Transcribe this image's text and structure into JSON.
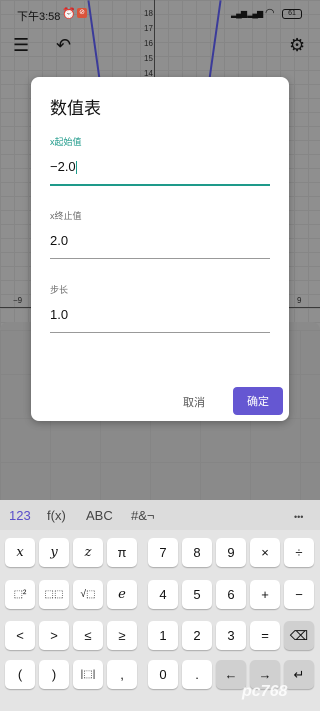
{
  "status": {
    "time": "下午3:58",
    "alarm_icon": "alarm-icon",
    "notif": "⊘",
    "battery": "61"
  },
  "toolbar": {
    "menu_icon": "menu-icon",
    "undo_icon": "undo-icon",
    "settings_icon": "gear-icon"
  },
  "graph": {
    "y_ticks": [
      "18",
      "17",
      "16",
      "15",
      "14"
    ],
    "x_ticks": [
      "−9",
      "9"
    ]
  },
  "dialog": {
    "title": "数值表",
    "fields": [
      {
        "label": "x起始值",
        "value": "−2.0"
      },
      {
        "label": "x终止值",
        "value": "2.0"
      },
      {
        "label": "步长",
        "value": "1.0"
      }
    ],
    "cancel": "取消",
    "ok": "确定"
  },
  "keyboard": {
    "tabs": [
      "123",
      "f(x)",
      "ABC",
      "#&¬"
    ],
    "more": "•••",
    "keys": {
      "x": "x",
      "y": "y",
      "z": "z",
      "pi": "π",
      "sq": "⬚²",
      "pow": "⬚⬚",
      "sqrt": "√⬚",
      "e": "e",
      "lt": "<",
      "gt": ">",
      "le": "≤",
      "ge": "≥",
      "lparen": "(",
      "rparen": ")",
      "abs": "|⬚|",
      "comma": ",",
      "n7": "7",
      "n8": "8",
      "n9": "9",
      "mul": "×",
      "div": "÷",
      "n4": "4",
      "n5": "5",
      "n6": "6",
      "plus": "+",
      "minus": "−",
      "n1": "1",
      "n2": "2",
      "n3": "3",
      "eq": "=",
      "backspace": "⌫",
      "n0": "0",
      "dot": ".",
      "left": "←",
      "right": "→",
      "enter": "↵"
    }
  },
  "watermark": "pc768"
}
